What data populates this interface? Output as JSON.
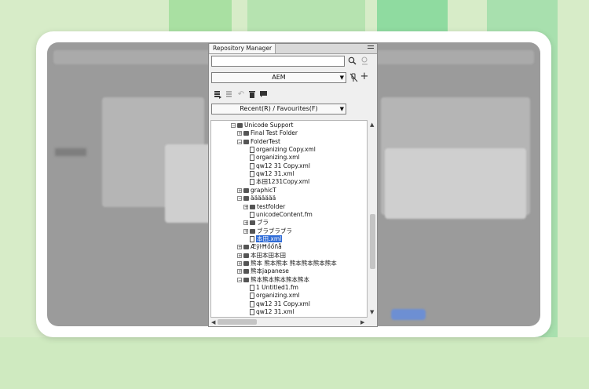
{
  "panel": {
    "tab_title": "Repository Manager",
    "search": {
      "value": "",
      "placeholder": ""
    },
    "connection_select": "AEM",
    "filter_select": "Recent(R) / Favourites(F)"
  },
  "icons": {
    "search": "search-icon",
    "user_search": "user-search-icon",
    "disconnect": "disconnect-icon",
    "add": "plus-icon",
    "checkout": "checkout-icon",
    "checkin": "checkin-icon",
    "undo": "undo-checkout-icon",
    "delete": "trash-icon",
    "comment": "comment-icon",
    "menu": "panel-menu-icon"
  },
  "tree": [
    {
      "label": "Unicode Support",
      "type": "folder",
      "level": 0,
      "expander": "−"
    },
    {
      "label": "Final Test Folder",
      "type": "folder",
      "level": 1,
      "expander": "+"
    },
    {
      "label": "FolderTest",
      "type": "folder",
      "level": 1,
      "expander": "−"
    },
    {
      "label": "organizing Copy.xml",
      "type": "file",
      "level": 2,
      "expander": ""
    },
    {
      "label": "organizing.xml",
      "type": "file",
      "level": 2,
      "expander": ""
    },
    {
      "label": "qw12 31 Copy.xml",
      "type": "file",
      "level": 2,
      "expander": ""
    },
    {
      "label": "qw12 31.xml",
      "type": "file",
      "level": 2,
      "expander": ""
    },
    {
      "label": "本田1231Copy.xml",
      "type": "file",
      "level": 2,
      "expander": ""
    },
    {
      "label": "graphicT",
      "type": "folder",
      "level": 1,
      "expander": "+"
    },
    {
      "label": "äääääää",
      "type": "folder",
      "level": 1,
      "expander": "−"
    },
    {
      "label": "testfolder",
      "type": "folder",
      "level": 2,
      "expander": "+"
    },
    {
      "label": "unicodeContent.fm",
      "type": "file",
      "level": 2,
      "expander": ""
    },
    {
      "label": "ブラ",
      "type": "folder",
      "level": 2,
      "expander": "+"
    },
    {
      "label": "ブラブラブラ",
      "type": "folder",
      "level": 2,
      "expander": "+"
    },
    {
      "label": "本田.xml",
      "type": "file",
      "level": 2,
      "expander": "",
      "selected": true
    },
    {
      "label": "ÆÿŀĦőőñå",
      "type": "folder",
      "level": 1,
      "expander": "+"
    },
    {
      "label": "本田本田本田",
      "type": "folder",
      "level": 1,
      "expander": "+"
    },
    {
      "label": "熊本    熊本熊本 熊本熊本熊本熊本",
      "type": "folder",
      "level": 1,
      "expander": "+"
    },
    {
      "label": "熊本japanese",
      "type": "folder",
      "level": 1,
      "expander": "+"
    },
    {
      "label": "熊本熊本熊本熊本熊本",
      "type": "folder",
      "level": 1,
      "expander": "−"
    },
    {
      "label": "1 Untitled1.fm",
      "type": "file",
      "level": 2,
      "expander": ""
    },
    {
      "label": "organizing.xml",
      "type": "file",
      "level": 2,
      "expander": ""
    },
    {
      "label": "qw12 31 Copy.xml",
      "type": "file",
      "level": 2,
      "expander": ""
    },
    {
      "label": "qw12 31.xml",
      "type": "file",
      "level": 2,
      "expander": ""
    }
  ],
  "colors": {
    "selection": "#2f6bd6",
    "background_green": "#d7ecc8"
  }
}
